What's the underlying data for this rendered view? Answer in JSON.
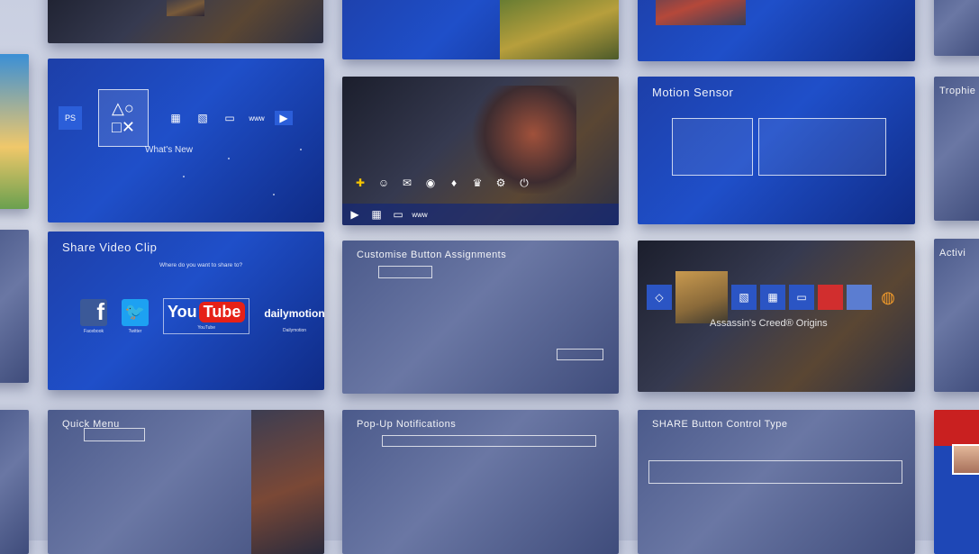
{
  "colors": {
    "ps_blue": "#1f4fc9",
    "youtube_red": "#e62117",
    "facebook": "#3b5998",
    "twitter": "#1da1f2"
  },
  "home": {
    "whats_new": "What's New"
  },
  "game": {
    "title": "Assassin's Creed® Origins"
  },
  "motion": {
    "title": "Motion Sensor"
  },
  "share": {
    "title": "Share Video Clip",
    "prompt": "Where do you want to share to?",
    "services": [
      {
        "name": "Facebook",
        "icon": "facebook-logo",
        "caption": "Facebook"
      },
      {
        "name": "Twitter",
        "icon": "twitter-logo",
        "caption": "Twitter"
      },
      {
        "name": "YouTube",
        "icon": "youtube-logo",
        "caption": "YouTube"
      },
      {
        "name": "dailymotion",
        "icon": "dailymotion-logo",
        "caption": "Dailymotion"
      }
    ]
  },
  "custom": {
    "title": "Customise Button Assignments"
  },
  "quick": {
    "title": "Quick Menu"
  },
  "popup": {
    "title": "Pop-Up Notifications"
  },
  "share_btn": {
    "title": "SHARE Button Control Type"
  },
  "right_edge": {
    "trophies": "Trophie",
    "activity": "Activi"
  }
}
